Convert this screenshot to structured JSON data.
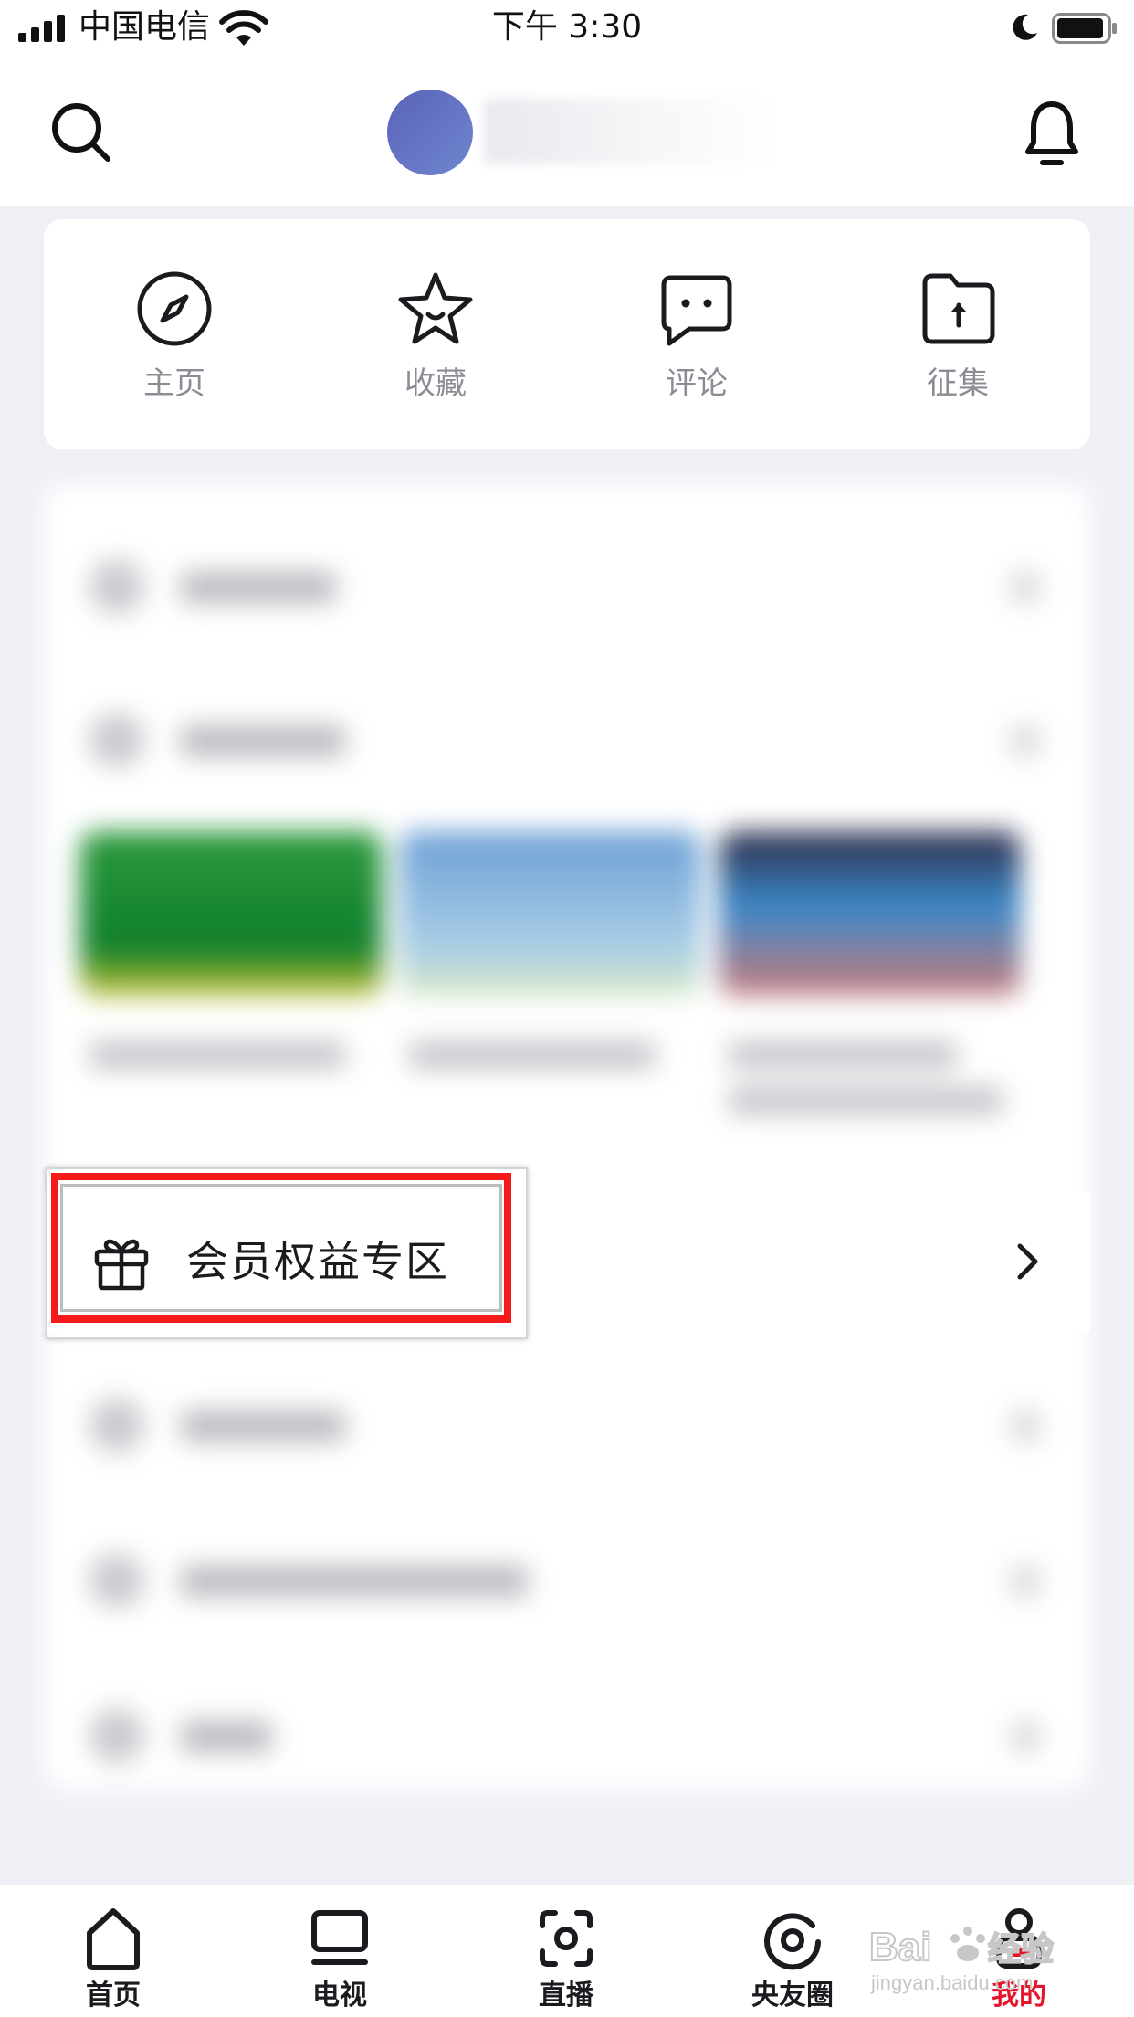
{
  "status_bar": {
    "carrier": "中国电信",
    "time": "下午 3:30"
  },
  "header": {
    "search_icon": "search-icon",
    "avatar": "avatar",
    "bell_icon": "bell-icon"
  },
  "quick_links": [
    {
      "label": "主页",
      "icon": "compass-icon"
    },
    {
      "label": "收藏",
      "icon": "star-icon"
    },
    {
      "label": "评论",
      "icon": "comment-icon"
    },
    {
      "label": "征集",
      "icon": "upload-folder-icon"
    }
  ],
  "menu": {
    "vip_label": "会员权益专区",
    "vip_icon": "gift-icon"
  },
  "tabs": [
    {
      "label": "首页",
      "icon": "home-icon",
      "active": false
    },
    {
      "label": "电视",
      "icon": "tv-icon",
      "active": false
    },
    {
      "label": "直播",
      "icon": "live-icon",
      "active": false
    },
    {
      "label": "央友圈",
      "icon": "circle-icon",
      "active": false
    },
    {
      "label": "我的",
      "icon": "profile-icon",
      "active": true
    }
  ],
  "colors": {
    "accent_red": "#e5162b",
    "highlight_red": "#f41a1a",
    "page_bg": "#eef0f6"
  },
  "watermark": {
    "brand": "Baidu",
    "subtitle": "jingyan.baidu.com"
  }
}
